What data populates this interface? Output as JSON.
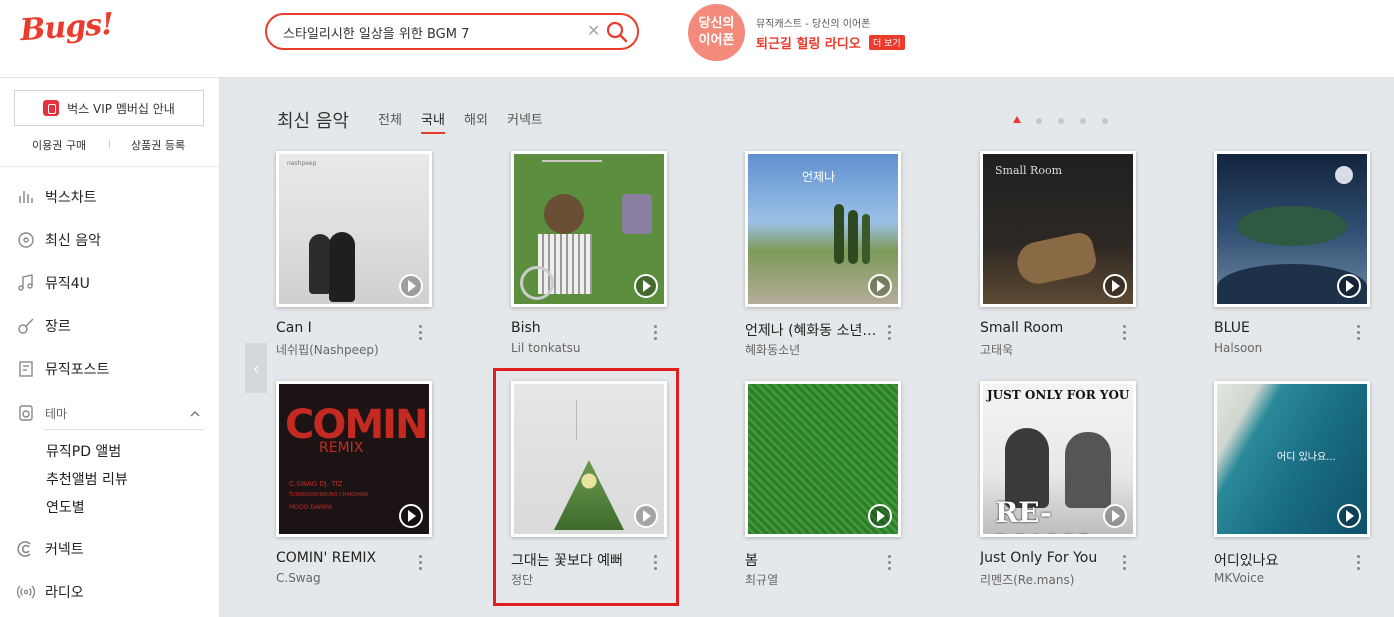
{
  "header": {
    "logo": "Bugs!",
    "search": {
      "value": "스타일리시한 일상을 위한 BGM 7",
      "placeholder": ""
    },
    "promo": {
      "circle_line1": "당신의",
      "circle_line2": "이어폰",
      "subtitle": "뮤직캐스트 - 당신의 이어폰",
      "title": "퇴근길 힐링 라디오",
      "more": "더 보기"
    }
  },
  "sidebar": {
    "vip": "벅스 VIP 멤버십 안내",
    "buy": "이용권 구매",
    "register": "상품권 등록",
    "nav": [
      "벅스차트",
      "최신 음악",
      "뮤직4U",
      "장르",
      "뮤직포스트"
    ],
    "theme": "테마",
    "theme_items": [
      "뮤직PD 앨범",
      "추천앨범 리뷰",
      "연도별"
    ],
    "connect": "커넥트",
    "radio": "라디오"
  },
  "main": {
    "section_title": "최신 음악",
    "tabs": [
      "전체",
      "국내",
      "해외",
      "커넥트"
    ],
    "active_tab": "국내",
    "albums": [
      {
        "title": "Can I",
        "artist": "네쉬핍(Nashpeep)",
        "cover_text": "nashpeep"
      },
      {
        "title": "Bish",
        "artist": "Lil tonkatsu",
        "cover_text": ""
      },
      {
        "title": "언제나 (혜화동 소년 …",
        "artist": "혜화동소년",
        "cover_text": "언제나"
      },
      {
        "title": "Small Room",
        "artist": "고태욱",
        "cover_text": "Small Room"
      },
      {
        "title": "BLUE",
        "artist": "Halsoon",
        "cover_text": ""
      },
      {
        "title": "COMIN' REMIX",
        "artist": "C.Swag",
        "cover_text": "COMIN"
      },
      {
        "title": "그대는 꽃보다 예뻐",
        "artist": "정단",
        "cover_text": ""
      },
      {
        "title": "봄",
        "artist": "최규열",
        "cover_text": ""
      },
      {
        "title": "Just Only For You",
        "artist": "리멘즈(Re.mans)",
        "cover_text": "JUST ONLY FOR YOU"
      },
      {
        "title": "어디있나요",
        "artist": "MKVoice",
        "cover_text": "어디 있나요..."
      }
    ],
    "cover_extra": {
      "comin_sub": "REMIX",
      "comin_credits1": "C.SWAG   DJ. TIZ",
      "comin_credits2": "TURNSOON  BRUNO CHAKRMAN",
      "comin_credits3": "MOOO   DAMINI",
      "remans_name": "RE-MANS"
    }
  },
  "colors": {
    "brand": "#ea3b2c",
    "highlight": "#e02020",
    "main_bg": "#e5e8eb"
  }
}
